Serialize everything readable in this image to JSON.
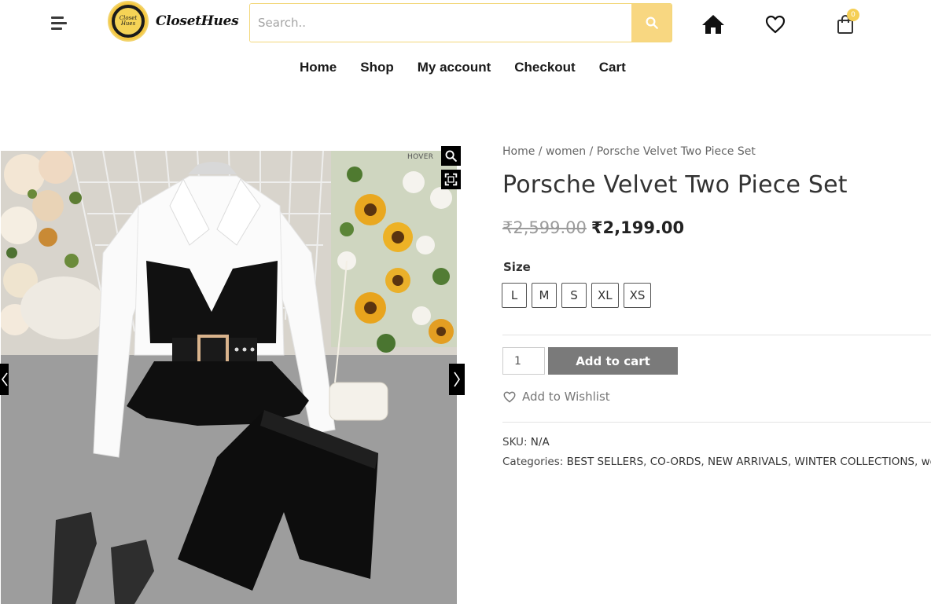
{
  "header": {
    "brand_name": "ClosetHues",
    "brand_badge_text": "Closet Hues",
    "search_placeholder": "Search..",
    "cart_count": "0"
  },
  "nav": {
    "items": [
      {
        "label": "Home"
      },
      {
        "label": "Shop"
      },
      {
        "label": "My account"
      },
      {
        "label": "Checkout"
      },
      {
        "label": "Cart"
      }
    ]
  },
  "gallery": {
    "hover_hint": "HOVER"
  },
  "breadcrumb": {
    "home": "Home",
    "sep1": " / ",
    "category": "women",
    "sep2": " / ",
    "current": "Porsche Velvet Two Piece Set"
  },
  "product": {
    "title": "Porsche Velvet Two Piece Set",
    "price_old": "₹2,599.00",
    "price_new": "₹2,199.00",
    "size_label": "Size",
    "sizes": [
      "L",
      "M",
      "S",
      "XL",
      "XS"
    ],
    "quantity": "1",
    "add_to_cart_label": "Add to cart",
    "wishlist_label": "Add to Wishlist",
    "sku_label": "SKU:",
    "sku_value": "N/A",
    "categories_label": "Categories:",
    "categories": [
      "BEST SELLERS",
      "CO-ORDS",
      "NEW ARRIVALS",
      "WINTER COLLECTIONS",
      "women"
    ]
  },
  "colors": {
    "accent_yellow": "#f8d781",
    "button_gray": "#7a7a7a"
  }
}
